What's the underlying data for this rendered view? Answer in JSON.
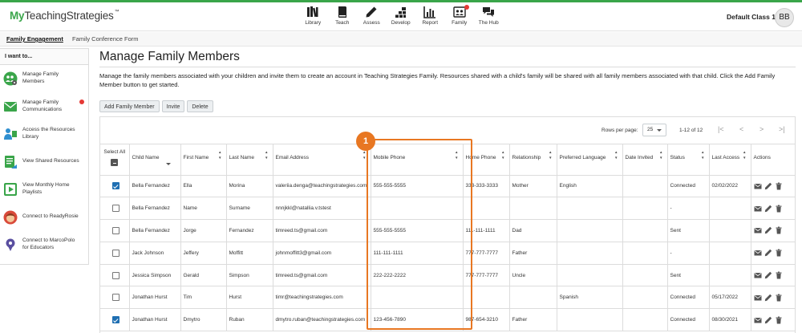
{
  "app": {
    "logo_prefix": "My",
    "logo_rest": "TeachingStrategies",
    "logo_tm": "™",
    "class_name": "Default Class 1",
    "avatar_initials": "BB",
    "accent_color": "#3aa54a"
  },
  "nav": [
    {
      "label": "Library",
      "icon": "library-icon"
    },
    {
      "label": "Teach",
      "icon": "book-icon"
    },
    {
      "label": "Assess",
      "icon": "pencil-icon"
    },
    {
      "label": "Develop",
      "icon": "blocks-icon"
    },
    {
      "label": "Report",
      "icon": "bar-chart-icon"
    },
    {
      "label": "Family",
      "icon": "family-icon",
      "notification": true
    },
    {
      "label": "The Hub",
      "icon": "chat-icon"
    }
  ],
  "subnav": {
    "tab1": "Family Engagement",
    "tab2": "Family Conference Form"
  },
  "sidebar": {
    "heading": "I want to...",
    "items": [
      {
        "label": "Manage Family Members",
        "icon": "family-settings-icon"
      },
      {
        "label": "Manage Family Communications",
        "icon": "envelope-icon",
        "notification": true
      },
      {
        "label": "Access the Resources Library",
        "icon": "person-resources-icon"
      },
      {
        "label": "View Shared Resources",
        "icon": "shared-doc-icon"
      },
      {
        "label": "View Monthly Home Playlists",
        "icon": "play-icon"
      },
      {
        "label": "Connect to ReadyRosie",
        "icon": "readyrosie-icon"
      },
      {
        "label": "Connect to MarcoPolo for Educators",
        "icon": "marcopolo-icon"
      }
    ]
  },
  "main": {
    "title": "Manage Family Members",
    "description": "Manage the family members associated with your children and invite them to create an account in Teaching Strategies Family. Resources shared with a child's family will be shared with all family members associated with that child. Click the Add Family Member button to get started.",
    "buttons": {
      "add": "Add Family Member",
      "invite": "Invite",
      "delete": "Delete"
    }
  },
  "table": {
    "rows_per_page_label": "Rows per page:",
    "rows_per_page": "25",
    "range": "1-12 of 12",
    "pager": {
      "first": "|<",
      "prev": "<",
      "next": ">",
      "last": ">|"
    },
    "select_all_label": "Select All",
    "columns": [
      "Child Name",
      "First Name",
      "Last Name",
      "Email Address",
      "Mobile Phone",
      "Home Phone",
      "Relationship",
      "Preferred Language",
      "Date Invited",
      "Status",
      "Last Access",
      "Actions"
    ],
    "rows": [
      {
        "checked": true,
        "child": "Bella Fernandez",
        "first": "Ella",
        "last": "Morina",
        "email": "valeriia.denga@teachingstrategies.com",
        "mobile": "555-555-5555",
        "home": "333-333-3333",
        "relationship": "Mother",
        "language": "English",
        "invited": "",
        "status": "Connected",
        "last_access": "02/02/2022"
      },
      {
        "checked": false,
        "child": "Bella Fernandez",
        "first": "Name",
        "last": "Surname",
        "email": "nnnjkkl@natallia.v.tstest",
        "mobile": "",
        "home": "",
        "relationship": "",
        "language": "",
        "invited": "",
        "status": "-",
        "last_access": ""
      },
      {
        "checked": false,
        "child": "Bella Fernandez",
        "first": "Jorge",
        "last": "Fernandez",
        "email": "timreed.ts@gmail.com",
        "mobile": "555-555-5555",
        "home": "111-111-1111",
        "relationship": "Dad",
        "language": "",
        "invited": "",
        "status": "Sent",
        "last_access": ""
      },
      {
        "checked": false,
        "child": "Jack Johnson",
        "first": "Jeffery",
        "last": "Moffitt",
        "email": "johnmoffitt3@gmail.com",
        "mobile": "111-111-1111",
        "home": "777-777-7777",
        "relationship": "Father",
        "language": "",
        "invited": "",
        "status": "-",
        "last_access": ""
      },
      {
        "checked": false,
        "child": "Jessica Simpson",
        "first": "Gerald",
        "last": "Simpson",
        "email": "timreed.ts@gmail.com",
        "mobile": "222-222-2222",
        "home": "777-777-7777",
        "relationship": "Uncle",
        "language": "",
        "invited": "",
        "status": "Sent",
        "last_access": ""
      },
      {
        "checked": false,
        "child": "Jonathan Hurst",
        "first": "Tim",
        "last": "Hurst",
        "email": "timr@teachingstrategies.com",
        "mobile": "",
        "home": "",
        "relationship": "",
        "language": "Spanish",
        "invited": "",
        "status": "Connected",
        "last_access": "05/17/2022"
      },
      {
        "checked": true,
        "child": "Jonathan Hurst",
        "first": "Dmytro",
        "last": "Ruban",
        "email": "dmytro.ruban@teachingstrategies.com",
        "mobile": "123-456-7890",
        "home": "987-654-3210",
        "relationship": "Father",
        "language": "",
        "invited": "",
        "status": "Connected",
        "last_access": "08/30/2021"
      }
    ]
  },
  "callout": {
    "number": "1",
    "color": "#e87722"
  }
}
